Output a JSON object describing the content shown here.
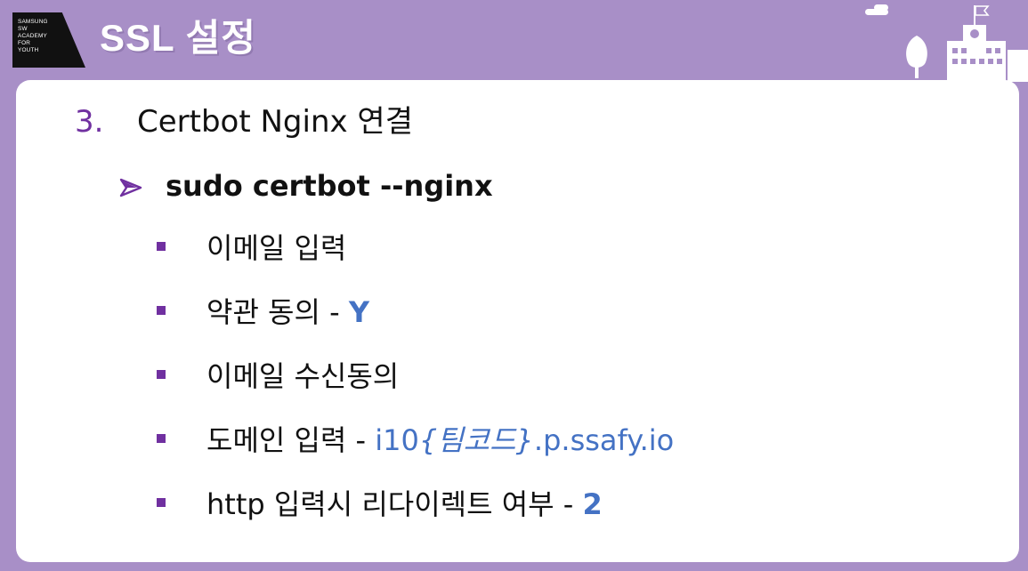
{
  "brand": {
    "logo_text": "SAMSUNG\nSW\nACADEMY\nFOR\nYOUTH"
  },
  "slide": {
    "title": "SSL 설정",
    "step_number": "3.",
    "step_text": "Certbot Nginx 연결",
    "command": "sudo certbot --nginx",
    "items": [
      {
        "text": "이메일 입력"
      },
      {
        "text": "약관 동의 - ",
        "value": "Y"
      },
      {
        "text": "이메일 수신동의"
      },
      {
        "text": "도메인 입력  - ",
        "value_prefix": "i10",
        "value_italic": "{팀코드}",
        "value_suffix": ".p.ssafy.io"
      },
      {
        "text": "http 입력시 리다이렉트 여부 - ",
        "value": "2"
      }
    ]
  },
  "colors": {
    "background": "#a88fc7",
    "accent_purple": "#7030a0",
    "accent_blue": "#4472c4"
  },
  "icons": [
    "arrow-bullet-icon",
    "square-bullet-icon",
    "tree-icon",
    "school-building-icon",
    "cloud-icon",
    "flag-icon"
  ]
}
